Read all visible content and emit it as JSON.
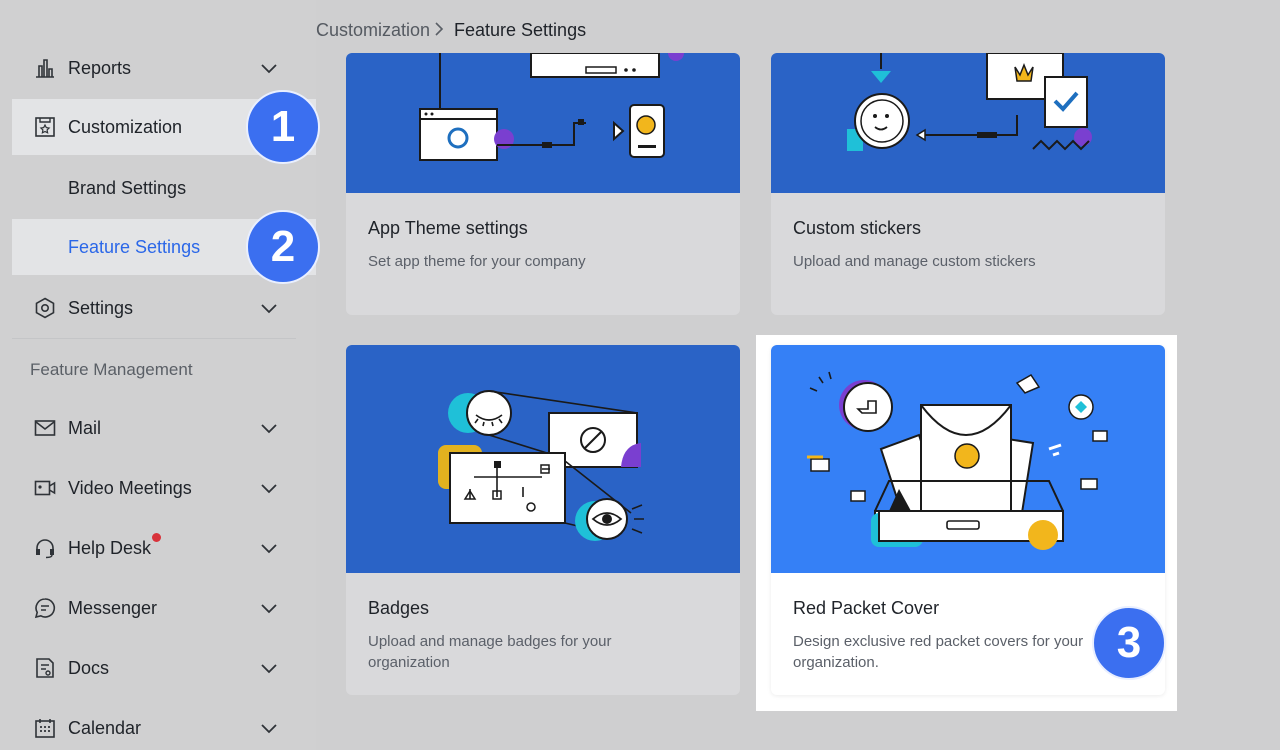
{
  "breadcrumb": {
    "parent": "Customization",
    "current": "Feature Settings"
  },
  "sidebar": {
    "items": [
      {
        "label": "Reports",
        "icon": "bar-chart-icon"
      },
      {
        "label": "Customization",
        "icon": "star-frame-icon"
      },
      {
        "label": "Brand Settings"
      },
      {
        "label": "Feature Settings"
      },
      {
        "label": "Settings",
        "icon": "hexagon-gear-icon"
      }
    ],
    "section_title": "Feature Management",
    "management": [
      {
        "label": "Mail",
        "icon": "mail-icon"
      },
      {
        "label": "Video Meetings",
        "icon": "video-icon"
      },
      {
        "label": "Help Desk",
        "icon": "headset-icon",
        "notification": true
      },
      {
        "label": "Messenger",
        "icon": "chat-icon"
      },
      {
        "label": "Docs",
        "icon": "doc-icon"
      },
      {
        "label": "Calendar",
        "icon": "calendar-icon"
      }
    ]
  },
  "annotations": [
    "1",
    "2",
    "3"
  ],
  "cards": [
    {
      "title": "App Theme settings",
      "desc": "Set app theme for your company"
    },
    {
      "title": "Custom stickers",
      "desc": "Upload and manage custom stickers"
    },
    {
      "title": "Badges",
      "desc": "Upload and manage badges for your organization"
    },
    {
      "title": "Red Packet Cover",
      "desc": "Design exclusive red packet covers for your organization."
    }
  ],
  "colors": {
    "accent": "#2b67e8",
    "badge": "#3b6ff0",
    "card_art": "#2a63c6",
    "card_art_bright": "#3580f6",
    "notification": "#d8323a"
  }
}
